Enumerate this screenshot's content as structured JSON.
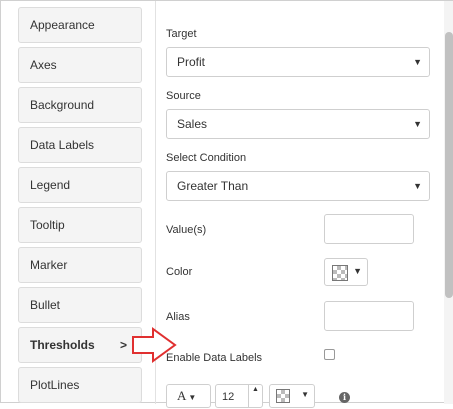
{
  "sidebar": {
    "items": [
      {
        "label": "Appearance"
      },
      {
        "label": "Axes"
      },
      {
        "label": "Background"
      },
      {
        "label": "Data Labels"
      },
      {
        "label": "Legend"
      },
      {
        "label": "Tooltip"
      },
      {
        "label": "Marker"
      },
      {
        "label": "Bullet"
      },
      {
        "label": "Thresholds",
        "active": true,
        "chevron": ">"
      },
      {
        "label": "PlotLines"
      }
    ]
  },
  "form": {
    "target": {
      "label": "Target",
      "value": "Profit"
    },
    "source": {
      "label": "Source",
      "value": "Sales"
    },
    "condition": {
      "label": "Select Condition",
      "value": "Greater Than"
    },
    "values": {
      "label": "Value(s)",
      "value": ""
    },
    "color": {
      "label": "Color"
    },
    "alias": {
      "label": "Alias",
      "value": ""
    },
    "enable_data_labels": {
      "label": "Enable Data Labels",
      "checked": false
    },
    "font": {
      "family_icon": "A",
      "size": "12"
    }
  },
  "icons": {
    "caret": "▼",
    "small_caret": "▾",
    "spin_up": "▲",
    "spin_down": "▼",
    "info": "i"
  },
  "colors": {
    "annotation_arrow": "#e03030",
    "scroll_thumb": "#c1c1c1"
  }
}
